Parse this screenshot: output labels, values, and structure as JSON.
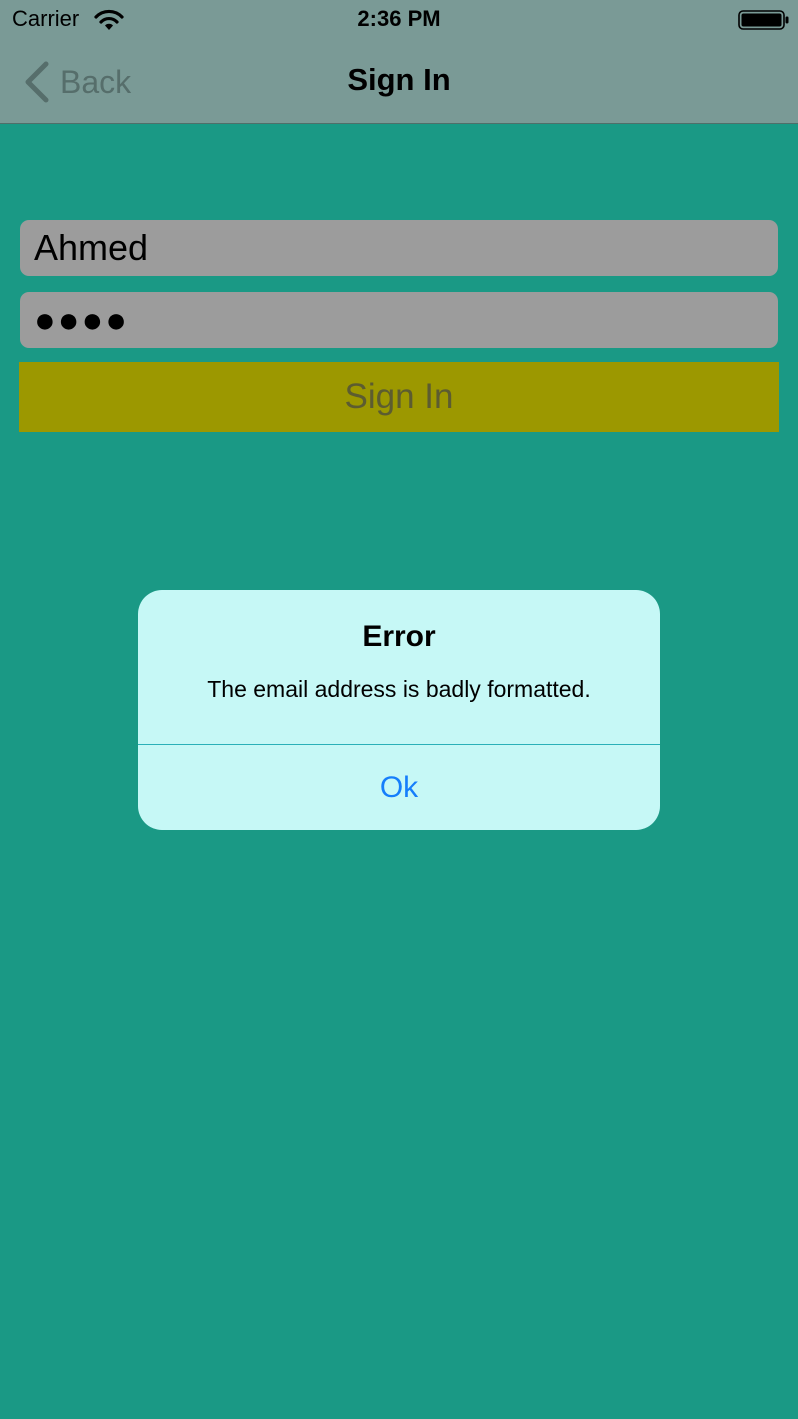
{
  "status_bar": {
    "carrier": "Carrier",
    "time": "2:36 PM"
  },
  "nav": {
    "back_label": "Back",
    "title": "Sign In"
  },
  "form": {
    "username_value": "Ahmed",
    "password_masked": "●●●●",
    "signin_label": "Sign In"
  },
  "alert": {
    "title": "Error",
    "message": "The email address is badly formatted.",
    "ok_label": "Ok"
  },
  "colors": {
    "background": "#1a9985",
    "header": "#7a9a96",
    "signin_button": "#9c9800",
    "alert_background": "#c6f8f6",
    "alert_action": "#157efb"
  },
  "icons": {
    "wifi": "wifi-icon",
    "battery": "battery-icon",
    "back": "chevron-left-icon"
  }
}
